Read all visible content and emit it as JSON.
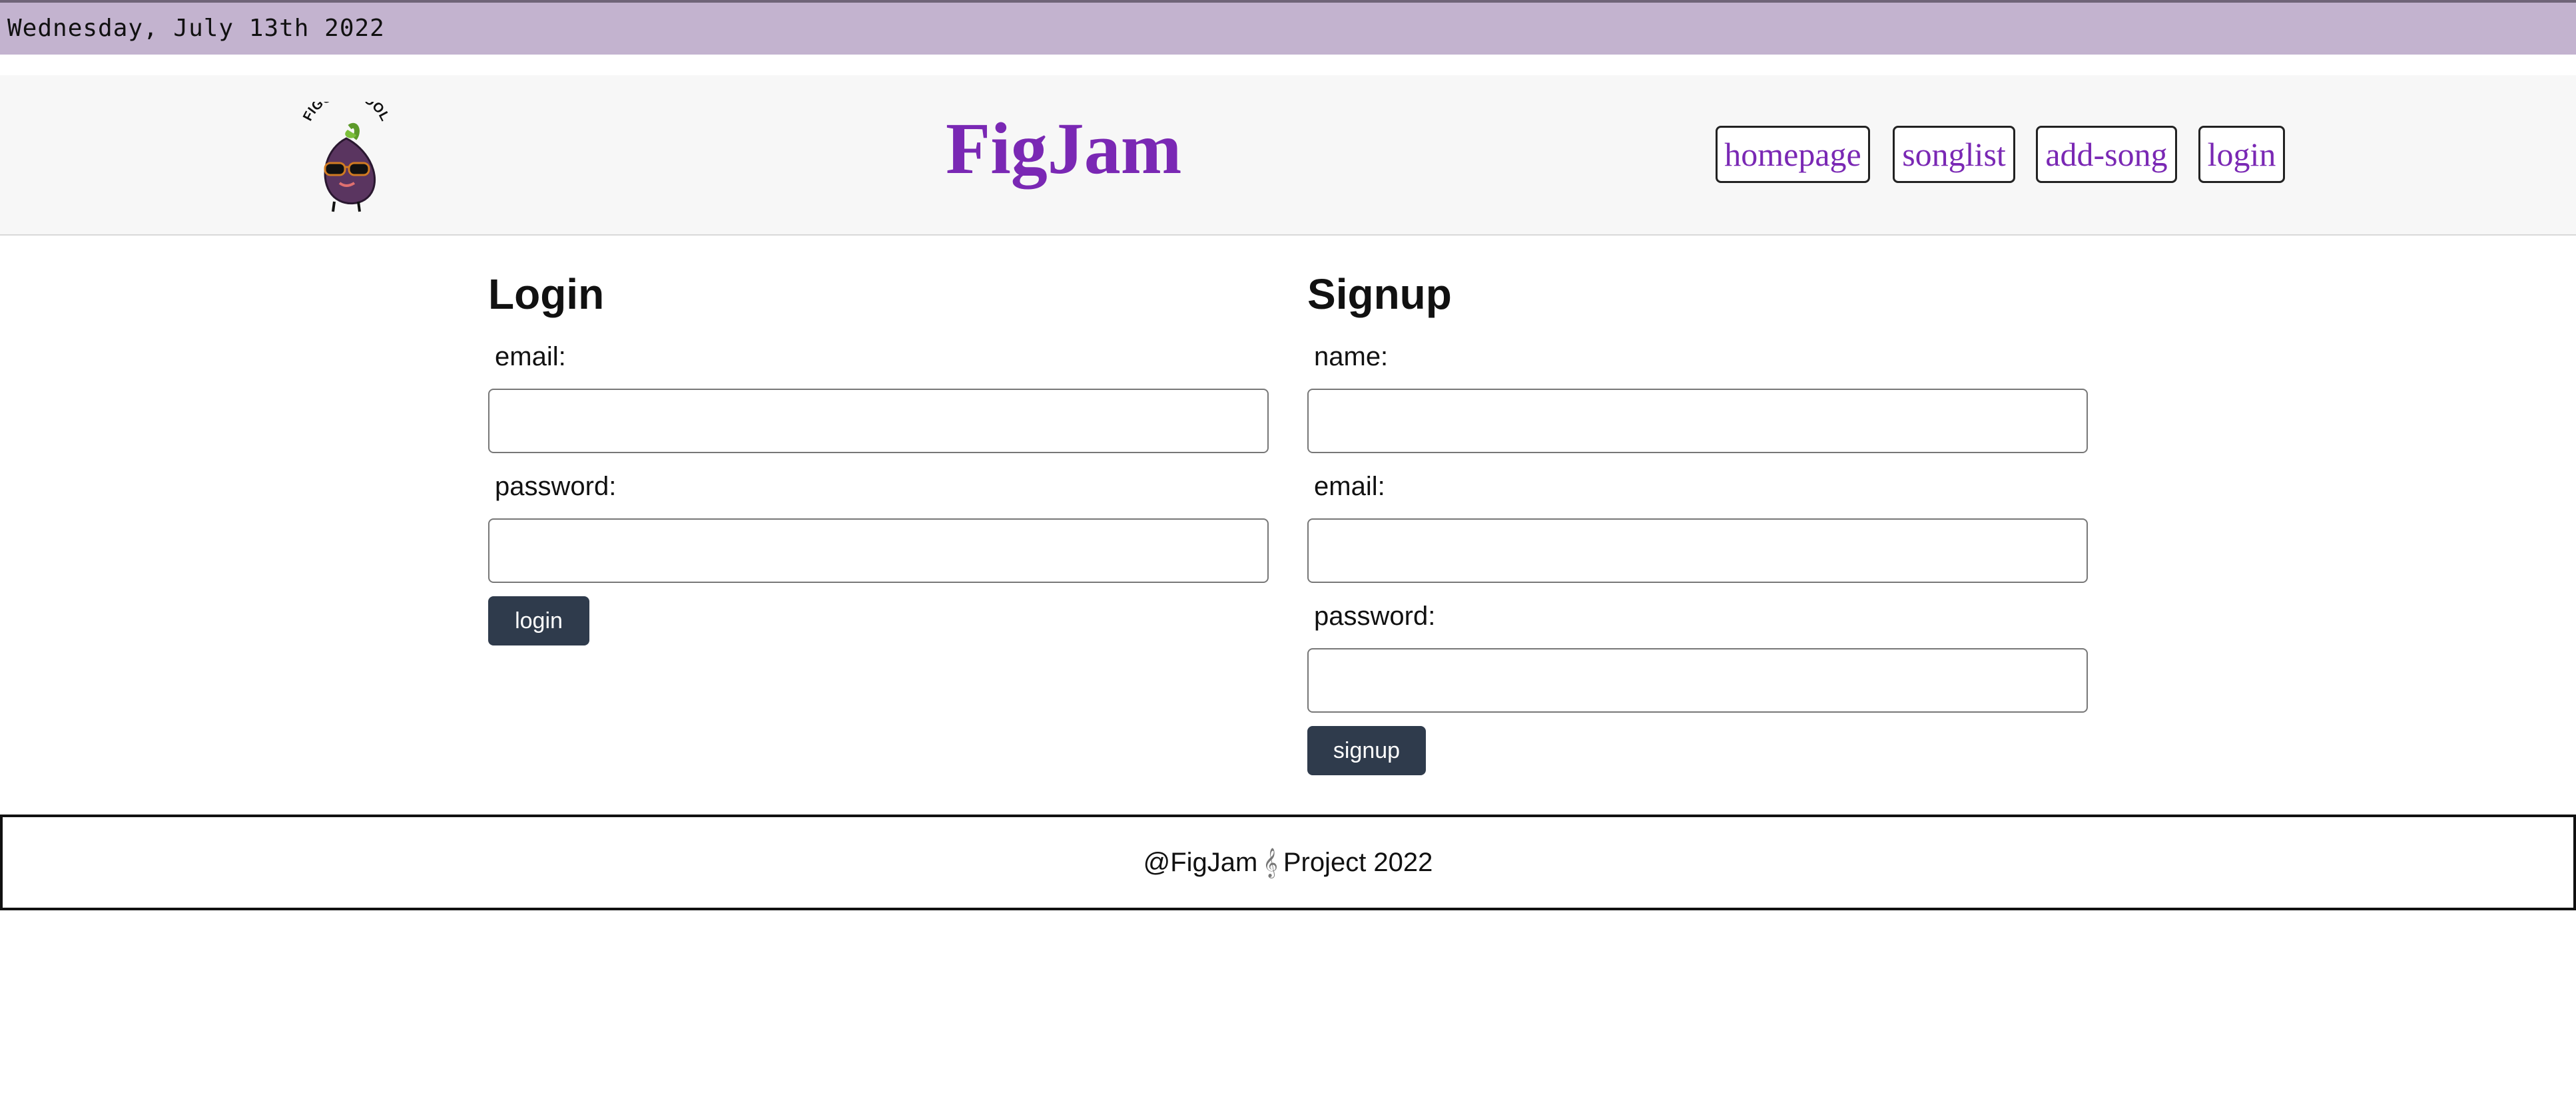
{
  "datebar": {
    "date": "Wednesday, July 13th 2022"
  },
  "header": {
    "logo_text": "FIGGIN' COOL",
    "brand": "FigJam",
    "nav": [
      {
        "label": "homepage"
      },
      {
        "label": "songlist"
      },
      {
        "label": "add-song"
      },
      {
        "label": "login"
      }
    ]
  },
  "login": {
    "title": "Login",
    "email_label": "email:",
    "email_value": "",
    "password_label": "password:",
    "password_value": "",
    "button": "login"
  },
  "signup": {
    "title": "Signup",
    "name_label": "name:",
    "name_value": "",
    "email_label": "email:",
    "email_value": "",
    "password_label": "password:",
    "password_value": "",
    "button": "signup"
  },
  "footer": {
    "left": "@FigJam",
    "icon": "music-note-icon",
    "right": "Project 2022"
  },
  "colors": {
    "datebar": "#c3b3cf",
    "brand_purple": "#7a28b4",
    "button": "#2f3b4c"
  }
}
